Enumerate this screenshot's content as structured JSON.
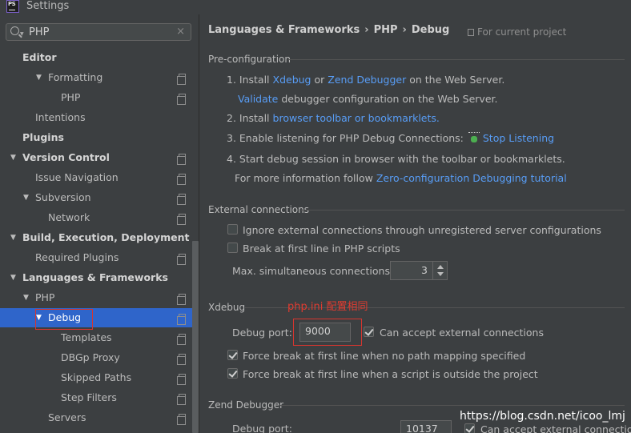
{
  "window": {
    "title": "Settings",
    "logo_text": "PS"
  },
  "search": {
    "value": "PHP",
    "clear_label": "×"
  },
  "tree": [
    {
      "label": "Editor",
      "bold": true
    },
    {
      "label": "Formatting",
      "expanded": true
    },
    {
      "label": "PHP"
    },
    {
      "label": "Intentions"
    },
    {
      "label": "Plugins",
      "bold": true
    },
    {
      "label": "Version Control",
      "bold": true,
      "expanded": true
    },
    {
      "label": "Issue Navigation"
    },
    {
      "label": "Subversion",
      "expanded": true
    },
    {
      "label": "Network"
    },
    {
      "label": "Build, Execution, Deployment",
      "bold": true,
      "expanded": true
    },
    {
      "label": "Required Plugins"
    },
    {
      "label": "Languages & Frameworks",
      "bold": true,
      "expanded": true
    },
    {
      "label": "PHP",
      "expanded": true
    },
    {
      "label": "Debug",
      "expanded": true,
      "selected": true
    },
    {
      "label": "Templates"
    },
    {
      "label": "DBGp Proxy"
    },
    {
      "label": "Skipped Paths"
    },
    {
      "label": "Step Filters"
    },
    {
      "label": "Servers"
    }
  ],
  "breadcrumb": {
    "part1": "Languages & Frameworks",
    "part2": "PHP",
    "part3": "Debug",
    "separator": "›"
  },
  "scope": {
    "label": "For current project"
  },
  "preconfig": {
    "title": "Pre-configuration",
    "step1_prefix": "1. Install",
    "step1_link1": "Xdebug",
    "step1_or": "or",
    "step1_link2": "Zend Debugger",
    "step1_suffix": "on the Web Server.",
    "validate_link": "Validate",
    "validate_suffix": "debugger configuration on the Web Server.",
    "step2_prefix": "2. Install",
    "step2_link": "browser toolbar or bookmarklets.",
    "step3_prefix": "3. Enable listening for PHP Debug Connections:",
    "step3_link": "Stop Listening",
    "step4": "4. Start debug session in browser with the toolbar or bookmarklets.",
    "more_prefix": "For more information follow",
    "more_link": "Zero-configuration Debugging tutorial"
  },
  "external": {
    "title": "External connections",
    "ignore_label": "Ignore external connections through unregistered server configurations",
    "ignore_checked": false,
    "break_label": "Break at first line in PHP scripts",
    "break_checked": false,
    "max_label": "Max. simultaneous connections:",
    "max_value": "3"
  },
  "xdebug": {
    "title": "Xdebug",
    "port_label": "Debug port:",
    "port_value": "9000",
    "accept_label": "Can accept external connections",
    "accept_checked": true,
    "force_no_mapping_label": "Force break at first line when no path mapping specified",
    "force_no_mapping_checked": true,
    "force_outside_label": "Force break at first line when a script is outside the project",
    "force_outside_checked": true
  },
  "annotation": "php.ini 配置相同",
  "zend": {
    "title": "Zend Debugger",
    "port_label": "Debug port:",
    "port_value": "10137",
    "accept_label": "Can accept external connections",
    "accept_checked": true
  },
  "watermark": "https://blog.csdn.net/icoo_lmj",
  "colors": {
    "link": "#589df6",
    "selection": "#2f65ca",
    "annotation_red": "#d7352f",
    "background": "#3c3f41"
  }
}
